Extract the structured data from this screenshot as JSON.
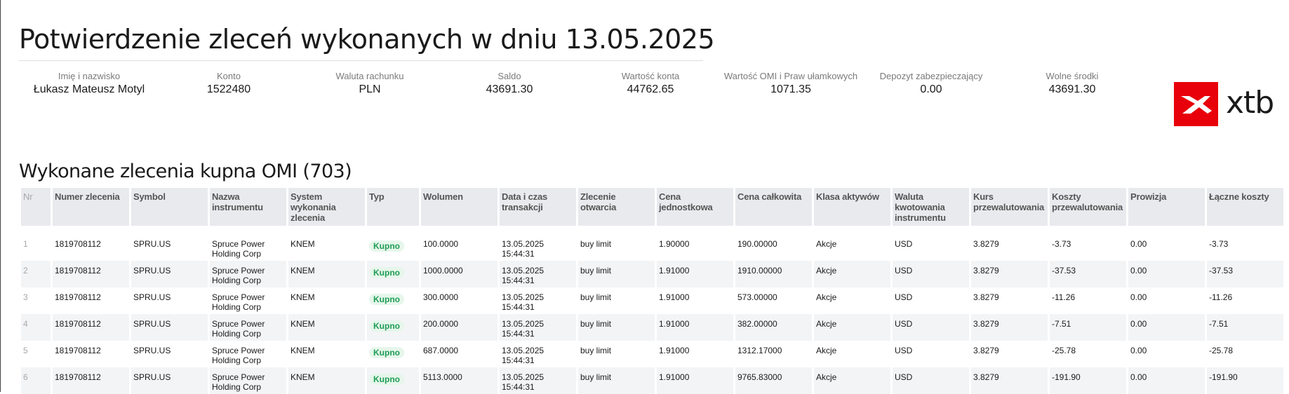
{
  "header": {
    "title": "Potwierdzenie zleceń wykonanych w dniu 13.05.2025"
  },
  "summary": [
    {
      "label": "Imię i nazwisko",
      "value": "Łukasz Mateusz Motyl"
    },
    {
      "label": "Konto",
      "value": "1522480"
    },
    {
      "label": "Waluta rachunku",
      "value": "PLN"
    },
    {
      "label": "Saldo",
      "value": "43691.30"
    },
    {
      "label": "Wartość konta",
      "value": "44762.65"
    },
    {
      "label": "Wartość OMI i Praw ułamkowych",
      "value": "1071.35"
    },
    {
      "label": "Depozyt zabezpieczający",
      "value": "0.00"
    },
    {
      "label": "Wolne środki",
      "value": "43691.30"
    }
  ],
  "logo": {
    "text": "xtb",
    "icon": "xtb-x-icon",
    "color": "#e8000b"
  },
  "section": {
    "title": "Wykonane zlecenia kupna OMI (703)"
  },
  "table": {
    "columns": [
      "Nr",
      "Numer zlecenia",
      "Symbol",
      "Nazwa instrumentu",
      "System wykonania zlecenia",
      "Typ",
      "Wolumen",
      "Data i czas transakcji",
      "Zlecenie otwarcia",
      "Cena jednostkowa",
      "Cena całkowita",
      "Klasa aktywów",
      "Waluta kwotowania instrumentu",
      "Kurs przewalutowania",
      "Koszty przewalutowania",
      "Prowizja",
      "Łączne koszty"
    ],
    "rows": [
      {
        "nr": "1",
        "order": "1819708112",
        "symbol": "SPRU.US",
        "name": "Spruce Power Holding Corp",
        "system": "KNEM",
        "type": "Kupno",
        "volume": "100.0000",
        "date": "13.05.2025 15:44:31",
        "open": "buy limit",
        "unit_price": "1.90000",
        "total_price": "190.00000",
        "asset_class": "Akcje",
        "currency": "USD",
        "fx_rate": "3.8279",
        "fx_cost": "-3.73",
        "commission": "0.00",
        "total_cost": "-3.73"
      },
      {
        "nr": "2",
        "order": "1819708112",
        "symbol": "SPRU.US",
        "name": "Spruce Power Holding Corp",
        "system": "KNEM",
        "type": "Kupno",
        "volume": "1000.0000",
        "date": "13.05.2025 15:44:31",
        "open": "buy limit",
        "unit_price": "1.91000",
        "total_price": "1910.00000",
        "asset_class": "Akcje",
        "currency": "USD",
        "fx_rate": "3.8279",
        "fx_cost": "-37.53",
        "commission": "0.00",
        "total_cost": "-37.53"
      },
      {
        "nr": "3",
        "order": "1819708112",
        "symbol": "SPRU.US",
        "name": "Spruce Power Holding Corp",
        "system": "KNEM",
        "type": "Kupno",
        "volume": "300.0000",
        "date": "13.05.2025 15:44:31",
        "open": "buy limit",
        "unit_price": "1.91000",
        "total_price": "573.00000",
        "asset_class": "Akcje",
        "currency": "USD",
        "fx_rate": "3.8279",
        "fx_cost": "-11.26",
        "commission": "0.00",
        "total_cost": "-11.26"
      },
      {
        "nr": "4",
        "order": "1819708112",
        "symbol": "SPRU.US",
        "name": "Spruce Power Holding Corp",
        "system": "KNEM",
        "type": "Kupno",
        "volume": "200.0000",
        "date": "13.05.2025 15:44:31",
        "open": "buy limit",
        "unit_price": "1.91000",
        "total_price": "382.00000",
        "asset_class": "Akcje",
        "currency": "USD",
        "fx_rate": "3.8279",
        "fx_cost": "-7.51",
        "commission": "0.00",
        "total_cost": "-7.51"
      },
      {
        "nr": "5",
        "order": "1819708112",
        "symbol": "SPRU.US",
        "name": "Spruce Power Holding Corp",
        "system": "KNEM",
        "type": "Kupno",
        "volume": "687.0000",
        "date": "13.05.2025 15:44:31",
        "open": "buy limit",
        "unit_price": "1.91000",
        "total_price": "1312.17000",
        "asset_class": "Akcje",
        "currency": "USD",
        "fx_rate": "3.8279",
        "fx_cost": "-25.78",
        "commission": "0.00",
        "total_cost": "-25.78"
      },
      {
        "nr": "6",
        "order": "1819708112",
        "symbol": "SPRU.US",
        "name": "Spruce Power Holding Corp",
        "system": "KNEM",
        "type": "Kupno",
        "volume": "5113.0000",
        "date": "13.05.2025 15:44:31",
        "open": "buy limit",
        "unit_price": "1.91000",
        "total_price": "9765.83000",
        "asset_class": "Akcje",
        "currency": "USD",
        "fx_rate": "3.8279",
        "fx_cost": "-191.90",
        "commission": "0.00",
        "total_cost": "-191.90"
      }
    ]
  },
  "colors": {
    "badge_bg": "#e6f6eb",
    "badge_text": "#1f9d55",
    "header_bg": "#e9eaee",
    "row_alt_bg": "#f3f4f6"
  }
}
